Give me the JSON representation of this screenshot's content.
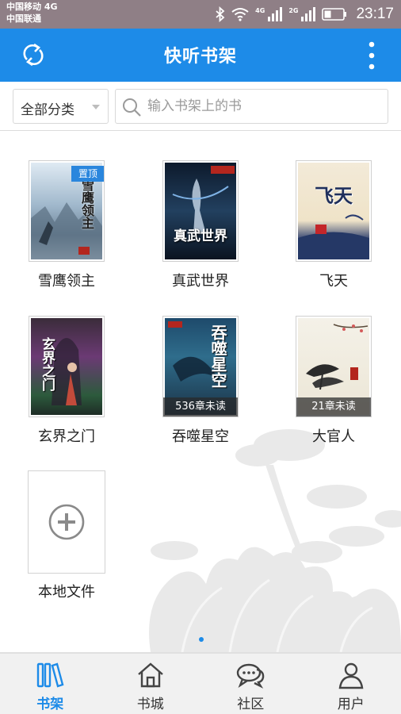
{
  "status_bar": {
    "carrier_1": "中国移动 4G",
    "carrier_2": "中国联通",
    "net_1": "4G",
    "net_2": "2G",
    "time": "23:17"
  },
  "app_bar": {
    "title": "快听书架",
    "refresh_icon": "refresh-icon",
    "more_icon": "more-vertical-icon"
  },
  "filter": {
    "category": "全部分类",
    "search_placeholder": "输入书架上的书"
  },
  "books": [
    {
      "title": "雪鹰领主",
      "cover_text": "雪鹰领主",
      "badge": "置顶",
      "unread": ""
    },
    {
      "title": "真武世界",
      "cover_text": "真武世界",
      "badge": "",
      "unread": ""
    },
    {
      "title": "飞天",
      "cover_text": "飞天",
      "badge": "",
      "unread": ""
    },
    {
      "title": "玄界之门",
      "cover_text": "玄界之门",
      "badge": "",
      "unread": ""
    },
    {
      "title": "吞噬星空",
      "cover_text": "吞噬星空",
      "badge": "",
      "unread": "536章未读"
    },
    {
      "title": "大官人",
      "cover_text": "",
      "badge": "",
      "unread": "21章未读"
    }
  ],
  "add_local": {
    "label": "本地文件",
    "icon": "add-circle-icon"
  },
  "pager": {
    "current": 1
  },
  "nav": [
    {
      "label": "书架",
      "icon": "bookshelf-icon",
      "active": true
    },
    {
      "label": "书城",
      "icon": "home-icon",
      "active": false
    },
    {
      "label": "社区",
      "icon": "chat-icon",
      "active": false
    },
    {
      "label": "用户",
      "icon": "user-icon",
      "active": false
    }
  ],
  "colors": {
    "accent": "#1d8be8",
    "status_bar": "#8f7f86",
    "nav_bg": "#f1f1f1"
  }
}
